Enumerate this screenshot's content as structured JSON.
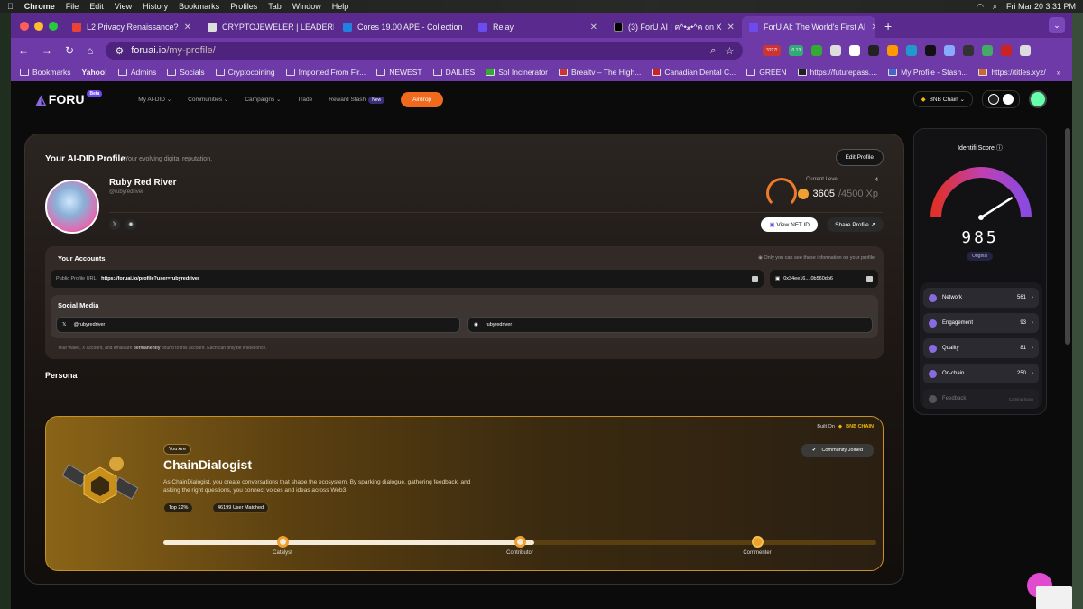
{
  "menubar": {
    "app": "Chrome",
    "items": [
      "File",
      "Edit",
      "View",
      "History",
      "Bookmarks",
      "Profiles",
      "Tab",
      "Window",
      "Help"
    ],
    "clock": "Fri Mar 20  3:31 PM"
  },
  "tabs": [
    {
      "label": "L2 Privacy Renaissance?"
    },
    {
      "label": "CRYPTOJEWELER | LEADERB"
    },
    {
      "label": "Cores 19.00 APE - Collection"
    },
    {
      "label": "Relay"
    },
    {
      "label": "(3) ForU AI | ฅ^•ﻌ•^ฅ on X"
    },
    {
      "label": "ForU AI: The World's First AI"
    }
  ],
  "address": {
    "domain": "foruai.io",
    "path": "/my-profile/"
  },
  "badge_value": "3227!",
  "badge_value2": "0.13",
  "bookmarks": [
    "Bookmarks",
    "Yahoo!",
    "Admins",
    "Socials",
    "Cryptocoining",
    "Imported From Fir...",
    "NEWEST",
    "DAILIES",
    "Sol Incinerator",
    "Brealtv – The High...",
    "Canadian Dental C...",
    "GREEN",
    "https://futurepass....",
    "My Profile - Stash...",
    "https://titles.xyz/"
  ],
  "bookmarks_more": "»",
  "sitenav": {
    "brand": "FORU",
    "beta": "Beta",
    "items": [
      "My AI-DID ⌄",
      "Communities ⌄",
      "Campaigns ⌄",
      "Trade",
      "Reward Stash"
    ],
    "new_badge": "New",
    "airdrop": "Airdrop",
    "chain": "BNB Chain ⌄"
  },
  "profile": {
    "title": "Your AI-DID Profile",
    "subtitle": "Your evolving digital reputation.",
    "edit": "Edit Profile",
    "name": "Ruby Red River",
    "handle": "@rubyredriver",
    "current_level_label": "Current Level",
    "level": "4",
    "xp": "3605",
    "xp_total": "/4500 Xp",
    "view_nft": "View NFT ID",
    "share": "Share Profile ↗"
  },
  "accounts": {
    "title": "Your Accounts",
    "note": "Only you can see these information on your profile",
    "url_label": "Public Profile URL:",
    "url": "https://foruai.io/profile?user=rubyredriver",
    "wallet": "0x34ee16....0b560db6",
    "social_title": "Social Media",
    "x_handle": "@rubyredriver",
    "discord": "rubyredriver",
    "foot_a": "Your wallet, X account, and email are ",
    "foot_b": "permanently",
    "foot_c": " bound to this account. Each can only be linked once."
  },
  "persona": {
    "section": "Persona",
    "built_on": "Built On",
    "chain": "BNB CHAIN",
    "you_are": "You Are",
    "name": "ChainDialogist",
    "desc": "As ChainDialogist, you create conversations that shape the ecosystem. By sparking dialogue, gathering feedback, and asking the right questions, you connect voices and ideas across Web3.",
    "tag1": "Top 22%",
    "tag2": "46199 User Matched",
    "community": "Community Joined",
    "stages": [
      "Catalyst",
      "Contributor",
      "Commenter"
    ],
    "progress": 0.52
  },
  "score": {
    "title": "Identifi Score ⓘ",
    "value": "985",
    "badge": "Original",
    "gauge_fraction": 0.82,
    "metrics": [
      {
        "label": "Network",
        "value": "561"
      },
      {
        "label": "Engagement",
        "value": "93"
      },
      {
        "label": "Quality",
        "value": "81"
      },
      {
        "label": "On-chain",
        "value": "250"
      }
    ],
    "feedback": "Feedback",
    "coming_soon": "Coming Soon"
  },
  "colors": {
    "browser": "#6d3aa8",
    "accent": "#f06a1d",
    "gold": "#c4912a",
    "metric": "#8a6ae0"
  }
}
